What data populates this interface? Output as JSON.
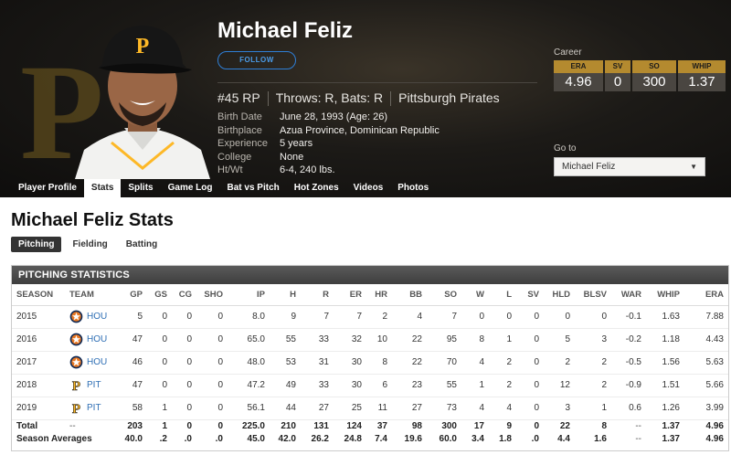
{
  "player": {
    "name": "Michael Feliz",
    "follow_label": "FOLLOW",
    "number_pos": "#45 RP",
    "throws_bats": "Throws: R, Bats: R",
    "team": "Pittsburgh Pirates",
    "bio": [
      {
        "k": "Birth Date",
        "v": "June 28, 1993 (Age: 26)"
      },
      {
        "k": "Birthplace",
        "v": "Azua Province, Dominican Republic"
      },
      {
        "k": "Experience",
        "v": "5 years"
      },
      {
        "k": "College",
        "v": "None"
      },
      {
        "k": "Ht/Wt",
        "v": "6-4, 240 lbs."
      }
    ]
  },
  "career": {
    "label": "Career",
    "stats": [
      {
        "h": "ERA",
        "v": "4.96"
      },
      {
        "h": "SV",
        "v": "0"
      },
      {
        "h": "SO",
        "v": "300"
      },
      {
        "h": "WHIP",
        "v": "1.37"
      }
    ]
  },
  "goto": {
    "label": "Go to",
    "value": "Michael Feliz"
  },
  "nav_tabs": [
    "Player Profile",
    "Stats",
    "Splits",
    "Game Log",
    "Bat vs Pitch",
    "Hot Zones",
    "Videos",
    "Photos"
  ],
  "page_title": "Michael Feliz Stats",
  "stat_tabs": [
    "Pitching",
    "Fielding",
    "Batting"
  ],
  "section_title": "PITCHING STATISTICS",
  "columns": [
    "SEASON",
    "TEAM",
    "GP",
    "GS",
    "CG",
    "SHO",
    "IP",
    "H",
    "R",
    "ER",
    "HR",
    "BB",
    "SO",
    "W",
    "L",
    "SV",
    "HLD",
    "BLSV",
    "WAR",
    "WHIP",
    "ERA"
  ],
  "rows": [
    {
      "team": "HOU",
      "logo": "astros-logo-icon",
      "cells": [
        "2015",
        "",
        "5",
        "0",
        "0",
        "0",
        "8.0",
        "9",
        "7",
        "7",
        "2",
        "4",
        "7",
        "0",
        "0",
        "0",
        "0",
        "0",
        "-0.1",
        "1.63",
        "7.88"
      ]
    },
    {
      "team": "HOU",
      "logo": "astros-logo-icon",
      "cells": [
        "2016",
        "",
        "47",
        "0",
        "0",
        "0",
        "65.0",
        "55",
        "33",
        "32",
        "10",
        "22",
        "95",
        "8",
        "1",
        "0",
        "5",
        "3",
        "-0.2",
        "1.18",
        "4.43"
      ]
    },
    {
      "team": "HOU",
      "logo": "astros-logo-icon",
      "cells": [
        "2017",
        "",
        "46",
        "0",
        "0",
        "0",
        "48.0",
        "53",
        "31",
        "30",
        "8",
        "22",
        "70",
        "4",
        "2",
        "0",
        "2",
        "2",
        "-0.5",
        "1.56",
        "5.63"
      ]
    },
    {
      "team": "PIT",
      "logo": "pirates-logo-icon",
      "cells": [
        "2018",
        "",
        "47",
        "0",
        "0",
        "0",
        "47.2",
        "49",
        "33",
        "30",
        "6",
        "23",
        "55",
        "1",
        "2",
        "0",
        "12",
        "2",
        "-0.9",
        "1.51",
        "5.66"
      ]
    },
    {
      "team": "PIT",
      "logo": "pirates-logo-icon",
      "cells": [
        "2019",
        "",
        "58",
        "1",
        "0",
        "0",
        "56.1",
        "44",
        "27",
        "25",
        "11",
        "27",
        "73",
        "4",
        "4",
        "0",
        "3",
        "1",
        "0.6",
        "1.26",
        "3.99"
      ]
    }
  ],
  "totals": [
    {
      "cells": [
        "Total",
        "--",
        "203",
        "1",
        "0",
        "0",
        "225.0",
        "210",
        "131",
        "124",
        "37",
        "98",
        "300",
        "17",
        "9",
        "0",
        "22",
        "8",
        "--",
        "1.37",
        "4.96"
      ]
    },
    {
      "cells": [
        "Season Averages",
        "",
        "40.0",
        ".2",
        ".0",
        ".0",
        "45.0",
        "42.0",
        "26.2",
        "24.8",
        "7.4",
        "19.6",
        "60.0",
        "3.4",
        "1.8",
        ".0",
        "4.4",
        "1.6",
        "--",
        "1.37",
        "4.96"
      ]
    }
  ],
  "colors": {
    "pirates_gold": "#fdb827",
    "header_dark": "#151311",
    "link_blue": "#2f6fb5"
  }
}
